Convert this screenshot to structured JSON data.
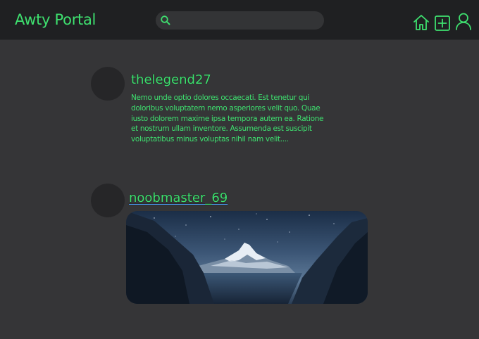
{
  "header": {
    "brand": "Awty Portal",
    "search": {
      "placeholder": "",
      "value": ""
    },
    "icons": [
      "home-icon",
      "add-post-icon",
      "profile-icon"
    ]
  },
  "posts": [
    {
      "username": "thelegend27",
      "text": "Nemo unde optio dolores occaecati. Est tenetur qui doloribus voluptatem nemo asperiores velit quo. Quae iusto dolorem maxime ipsa tempora autem ea. Ratione et nostrum ullam inventore. Assumenda est suscipit voluptatibus minus voluptas nihil nam velit...."
    },
    {
      "username": "noobmaster_69",
      "image": "mountain-night-sky"
    }
  ],
  "colors": {
    "accent": "#3ee06f",
    "background": "#353537",
    "topbar": "#1f2022",
    "link_underline": "#4aa3ff"
  }
}
